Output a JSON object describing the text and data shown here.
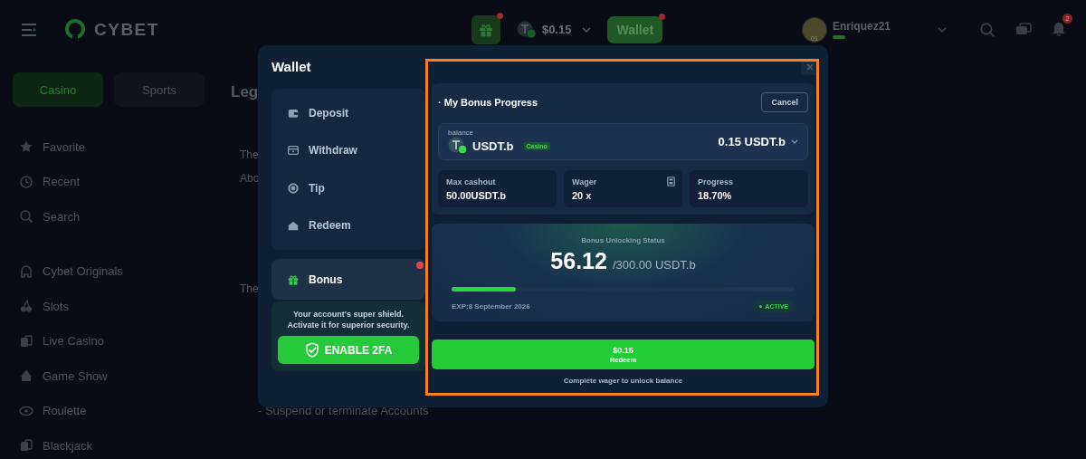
{
  "header": {
    "logo": "CYBET",
    "gift_notification": true,
    "balance": "$0.15",
    "wallet_button": "Wallet",
    "wallet_notification": true,
    "user": {
      "name": "Enriquez21",
      "level": "01"
    },
    "notifications": "2"
  },
  "sidebar": {
    "tabs": [
      {
        "label": "Casino",
        "selected": true
      },
      {
        "label": "Sports",
        "selected": false
      }
    ],
    "items": [
      {
        "label": "Favorite"
      },
      {
        "label": "Recent"
      },
      {
        "label": "Search"
      }
    ],
    "games": [
      {
        "label": "Cybet Originals"
      },
      {
        "label": "Slots"
      },
      {
        "label": "Live Casino"
      },
      {
        "label": "Game Show"
      },
      {
        "label": "Roulette"
      },
      {
        "label": "Blackjack"
      }
    ]
  },
  "page": {
    "heading": "Leg",
    "lines": [
      "The",
      "Abo",
      "The"
    ],
    "bullet": "- Suspend or terminate Accounts"
  },
  "wallet": {
    "title": "Wallet",
    "nav": [
      {
        "label": "Deposit",
        "selected": false,
        "notification": false
      },
      {
        "label": "Withdraw",
        "selected": false,
        "notification": false
      },
      {
        "label": "Tip",
        "selected": false,
        "notification": false
      },
      {
        "label": "Redeem",
        "selected": false,
        "notification": false
      },
      {
        "label": "Bonus",
        "selected": true,
        "notification": true
      }
    ],
    "security": {
      "message": "Your account's super shield.\nActivate it for superior security.",
      "button": "ENABLE 2FA"
    },
    "bonus": {
      "title": "· My Bonus Progress",
      "cancel": "Cancel",
      "balance_label": "balance",
      "currency": "USDT.b",
      "tag": "Casino",
      "amount": "0.15 USDT.b",
      "stats": [
        {
          "label": "Max cashout",
          "value": "50.00USDT.b",
          "calculator": false
        },
        {
          "label": "Wager",
          "value": "20 x",
          "calculator": true
        },
        {
          "label": "Progress",
          "value": "18.70%",
          "calculator": false
        }
      ],
      "status_title": "Bonus Unlocking Status",
      "unlocked": "56.12",
      "target": "/300.00 USDT.b",
      "level": 0.187,
      "expiry": "EXP:8 September 2026",
      "status": "ACTIVE",
      "redeem_amount": "$0.15",
      "redeem_label": "Redeem",
      "note": "Complete wager to unlock balance"
    }
  }
}
